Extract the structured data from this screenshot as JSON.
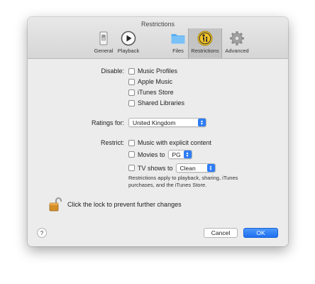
{
  "window": {
    "title": "Restrictions"
  },
  "toolbar": {
    "items": [
      {
        "label": "General",
        "icon": "switch-icon"
      },
      {
        "label": "Playback",
        "icon": "play-icon"
      },
      {
        "label": "Files",
        "icon": "folder-icon"
      },
      {
        "label": "Restrictions",
        "icon": "parental-controls-icon",
        "selected": true
      },
      {
        "label": "Advanced",
        "icon": "gear-icon"
      }
    ]
  },
  "disable": {
    "label": "Disable:",
    "options": [
      "Music Profiles",
      "Apple Music",
      "iTunes Store",
      "Shared Libraries"
    ]
  },
  "ratings": {
    "label": "Ratings for:",
    "value": "United Kingdom"
  },
  "restrict": {
    "label": "Restrict:",
    "explicit": "Music with explicit content",
    "movies_label": "Movies to",
    "movies_value": "PG",
    "tv_label": "TV shows to",
    "tv_value": "Clean",
    "note": "Restrictions apply to playback, sharing, iTunes purchases, and the iTunes Store."
  },
  "lock": {
    "text": "Click the lock to prevent further changes"
  },
  "buttons": {
    "help": "?",
    "cancel": "Cancel",
    "ok": "OK"
  },
  "colors": {
    "accent": "#2d7cf6",
    "window_bg": "#ececec",
    "selected_tab": "#c4c4c4"
  }
}
